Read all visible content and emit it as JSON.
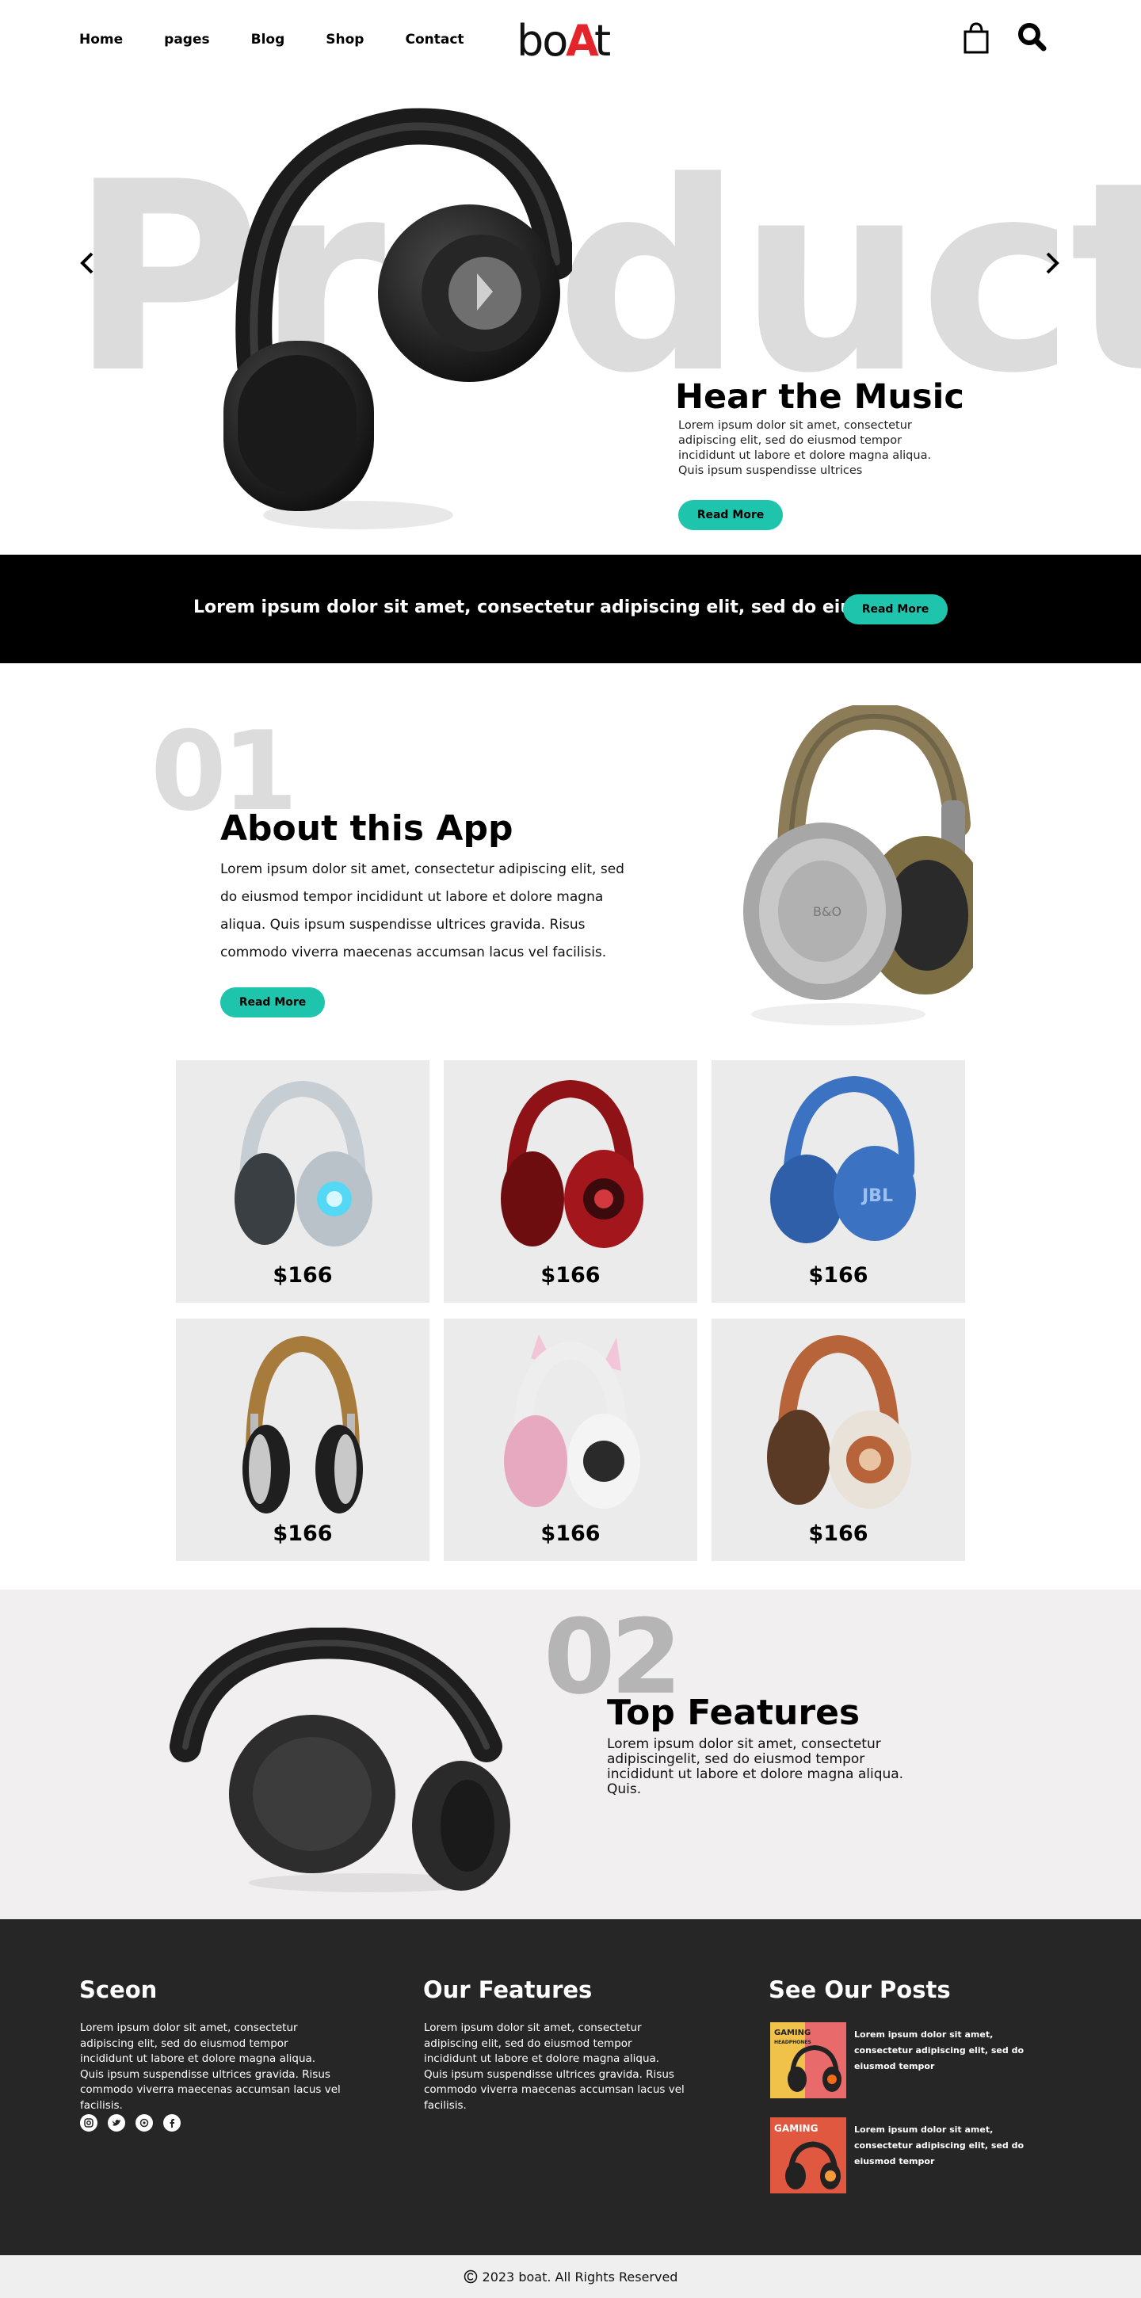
{
  "nav": {
    "links": [
      "Home",
      "pages",
      "Blog",
      "Shop",
      "Contact"
    ],
    "logo_text": "boAt",
    "icons": [
      "shopping-bag-icon",
      "search-icon"
    ]
  },
  "hero": {
    "background_word": "Product",
    "title": "Hear the Music",
    "text": "Lorem ipsum dolor sit amet, consectetur adipiscing elit, sed do eiusmod tempor incididunt ut labore et dolore magna aliqua. Quis ipsum suspendisse ultrices",
    "button_label": "Read More",
    "arrows": [
      "chevron-left-icon",
      "chevron-right-icon"
    ]
  },
  "banner": {
    "text": "Lorem ipsum dolor sit amet, consectetur adipiscing elit, sed do eius-",
    "button_label": "Read More"
  },
  "about": {
    "number": "01",
    "title": "About this App",
    "text": "Lorem ipsum dolor sit amet, consectetur adipiscing elit, sed do eiusmod tempor incididunt ut labore et dolore magna aliqua. Quis ipsum suspendisse ultrices gravida. Risus commodo viverra maecenas accumsan lacus vel facilisis.",
    "button_label": "Read More"
  },
  "products": [
    {
      "price": "$166",
      "color": "#b9c2c8"
    },
    {
      "price": "$166",
      "color": "#a3161b"
    },
    {
      "price": "$166",
      "color": "#3c72c2"
    },
    {
      "price": "$166",
      "color": "#a77b3c"
    },
    {
      "price": "$166",
      "color": "#e6a9c0"
    },
    {
      "price": "$166",
      "color": "#b7643a"
    }
  ],
  "features": {
    "number": "02",
    "title": "Top Features",
    "text": "Lorem ipsum dolor sit amet, consectetur adipiscingelit, sed do eiusmod tempor incididunt ut labore et dolore magna aliqua. Quis."
  },
  "footer": {
    "col1": {
      "title": "Sceon",
      "text": "Lorem ipsum dolor sit amet, consectetur adipiscing elit, sed do eiusmod tempor incididunt ut labore et dolore magna aliqua. Quis ipsum suspendisse ultrices gravida. Risus commodo viverra maecenas accumsan lacus vel facilisis.",
      "socials": [
        "instagram-icon",
        "twitter-icon",
        "whatsapp-icon",
        "facebook-icon"
      ]
    },
    "col2": {
      "title": "Our Features",
      "text": "Lorem ipsum dolor sit amet, consectetur adipiscing elit, sed do eiusmod tempor incididunt ut labore et dolore magna aliqua. Quis ipsum suspendisse ultrices gravida. Risus commodo viverra maecenas accumsan lacus vel facilisis."
    },
    "col3": {
      "title": "See Our Posts",
      "posts": [
        {
          "text": "Lorem ipsum dolor sit amet, consectetur adipiscing elit, sed do eiusmod tempor",
          "thumb_label": "GAMING HEADPHONES"
        },
        {
          "text": "Lorem ipsum dolor sit amet, consectetur adipiscing elit, sed do eiusmod tempor",
          "thumb_label": "GAMING"
        }
      ]
    }
  },
  "copyright": {
    "text": "2023 boat. All Rights Reserved"
  },
  "colors": {
    "accent": "#1fc4ad",
    "logo_red": "#e3242b",
    "banner_bg": "#000000",
    "footer_bg": "#262626",
    "card_bg": "#ebebeb",
    "features_bg": "#f1eff0"
  }
}
